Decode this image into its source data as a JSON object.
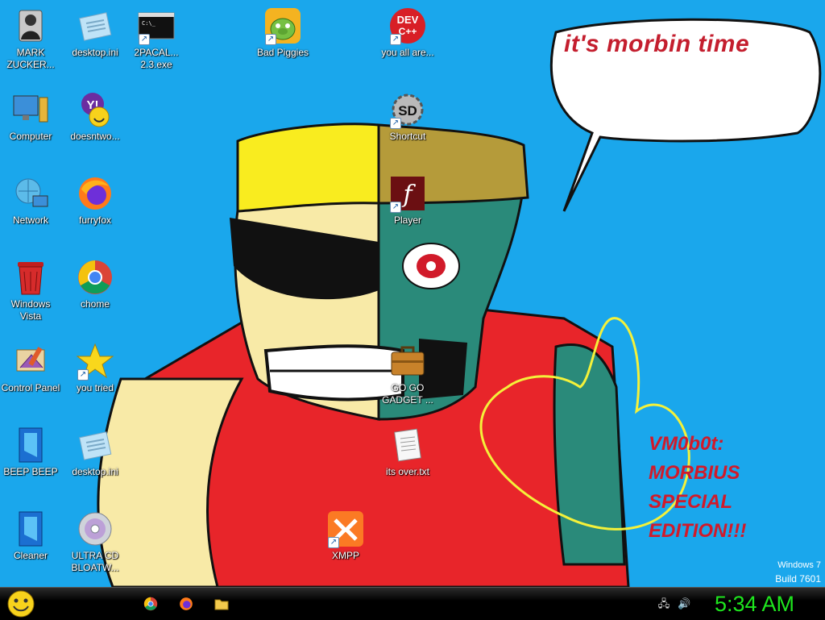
{
  "desktop": {
    "icons": [
      {
        "id": "mark-zucker",
        "label": "MARK ZUCKER...",
        "icon": "person-icon"
      },
      {
        "id": "desktop-ini-1",
        "label": "desktop.ini",
        "icon": "ini-file-icon"
      },
      {
        "id": "2pacal",
        "label": "2PACAL... 2.3.exe",
        "icon": "console-icon"
      },
      {
        "id": "bad-piggies",
        "label": "Bad Piggies",
        "icon": "pig-icon"
      },
      {
        "id": "you-all-are",
        "label": "you all are...",
        "icon": "dev-cpp-icon"
      },
      {
        "id": "computer",
        "label": "Computer",
        "icon": "computer-icon"
      },
      {
        "id": "doesntwo",
        "label": "doesntwo...",
        "icon": "yahoo-messenger-icon"
      },
      {
        "id": "shortcut",
        "label": "Shortcut",
        "icon": "gear-disc-icon"
      },
      {
        "id": "network",
        "label": "Network",
        "icon": "network-icon"
      },
      {
        "id": "furryfox",
        "label": "furryfox",
        "icon": "firefox-icon"
      },
      {
        "id": "player",
        "label": "Player",
        "icon": "flash-icon"
      },
      {
        "id": "windows-vista",
        "label": "Windows Vista",
        "icon": "recycle-bin-icon"
      },
      {
        "id": "chome",
        "label": "chome",
        "icon": "chrome-icon"
      },
      {
        "id": "control-panel",
        "label": "Control Panel",
        "icon": "control-panel-icon"
      },
      {
        "id": "you-tried",
        "label": "you tried",
        "icon": "star-icon"
      },
      {
        "id": "go-go-gadget",
        "label": "GO GO GADGET ...",
        "icon": "briefcase-icon"
      },
      {
        "id": "beep-beep",
        "label": "BEEP BEEP",
        "icon": "blue-panel-icon"
      },
      {
        "id": "desktop-ini-2",
        "label": "desktop.ini",
        "icon": "ini-file-icon"
      },
      {
        "id": "its-over",
        "label": "its over.txt",
        "icon": "text-file-icon"
      },
      {
        "id": "cleaner",
        "label": "Cleaner",
        "icon": "blue-panel-icon"
      },
      {
        "id": "ultra-cd",
        "label": "ULTRA CD BLOATW...",
        "icon": "cd-icon"
      },
      {
        "id": "xmpp",
        "label": "XMPP",
        "icon": "xampp-icon"
      }
    ]
  },
  "wallpaper": {
    "speech_text": "it's morbin time",
    "watermark_lines": [
      "VM0b0t:",
      "MORBIUS",
      "SPECIAL",
      "EDITION!!!"
    ]
  },
  "os": {
    "name": "Windows 7",
    "build": "Build 7601"
  },
  "taskbar": {
    "start_icon": "smiley-orb-icon",
    "pinned": [
      {
        "id": "chrome",
        "icon": "chrome-icon"
      },
      {
        "id": "firefox",
        "icon": "firefox-icon"
      },
      {
        "id": "explorer",
        "icon": "folder-icon"
      }
    ],
    "tray": [
      {
        "id": "network",
        "icon": "network-tray-icon"
      },
      {
        "id": "volume",
        "icon": "speaker-icon"
      }
    ],
    "clock": "5:34 AM"
  },
  "colors": {
    "desktop_bg": "#1aa7ec",
    "clock": "#1ee61e",
    "speech_text": "#c41e2e",
    "watermark": "#d11a2a"
  }
}
